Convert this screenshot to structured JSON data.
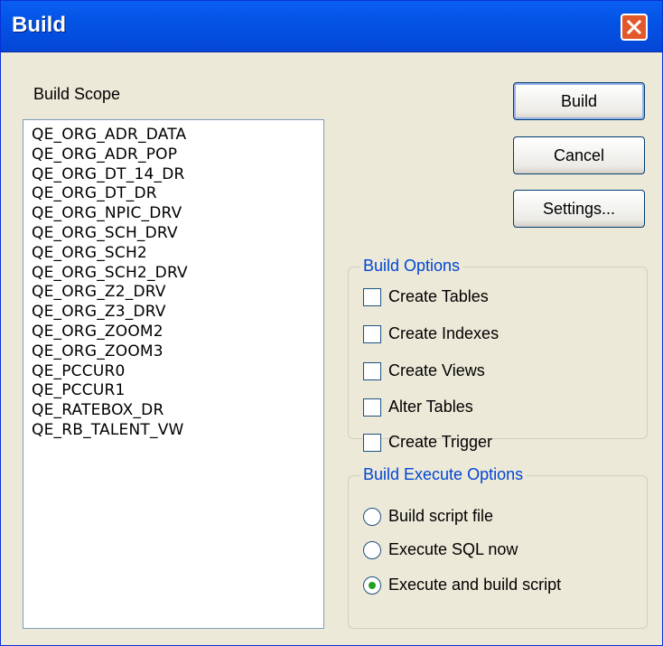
{
  "window": {
    "title": "Build"
  },
  "build_scope": {
    "label": "Build Scope",
    "items": [
      "QE_ORG_ADR_DATA",
      "QE_ORG_ADR_POP",
      "QE_ORG_DT_14_DR",
      "QE_ORG_DT_DR",
      "QE_ORG_NPIC_DRV",
      "QE_ORG_SCH_DRV",
      "QE_ORG_SCH2",
      "QE_ORG_SCH2_DRV",
      "QE_ORG_Z2_DRV",
      "QE_ORG_Z3_DRV",
      "QE_ORG_ZOOM2",
      "QE_ORG_ZOOM3",
      "QE_PCCUR0",
      "QE_PCCUR1",
      "QE_RATEBOX_DR",
      "QE_RB_TALENT_VW"
    ]
  },
  "buttons": {
    "build": "Build",
    "cancel": "Cancel",
    "settings": "Settings..."
  },
  "build_options": {
    "title": "Build Options",
    "items": [
      {
        "label": "Create Tables",
        "checked": false
      },
      {
        "label": "Create Indexes",
        "checked": false
      },
      {
        "label": "Create Views",
        "checked": false
      },
      {
        "label": "Alter Tables",
        "checked": false
      },
      {
        "label": "Create Trigger",
        "checked": false
      }
    ]
  },
  "execute_options": {
    "title": "Build Execute Options",
    "items": [
      {
        "label": "Build script file",
        "selected": false
      },
      {
        "label": "Execute SQL now",
        "selected": false
      },
      {
        "label": "Execute and build script",
        "selected": true
      }
    ]
  },
  "colors": {
    "titlebar": "#0454e6",
    "close": "#e2582b",
    "group_title": "#0046d5",
    "radio_dot": "#21a121"
  }
}
